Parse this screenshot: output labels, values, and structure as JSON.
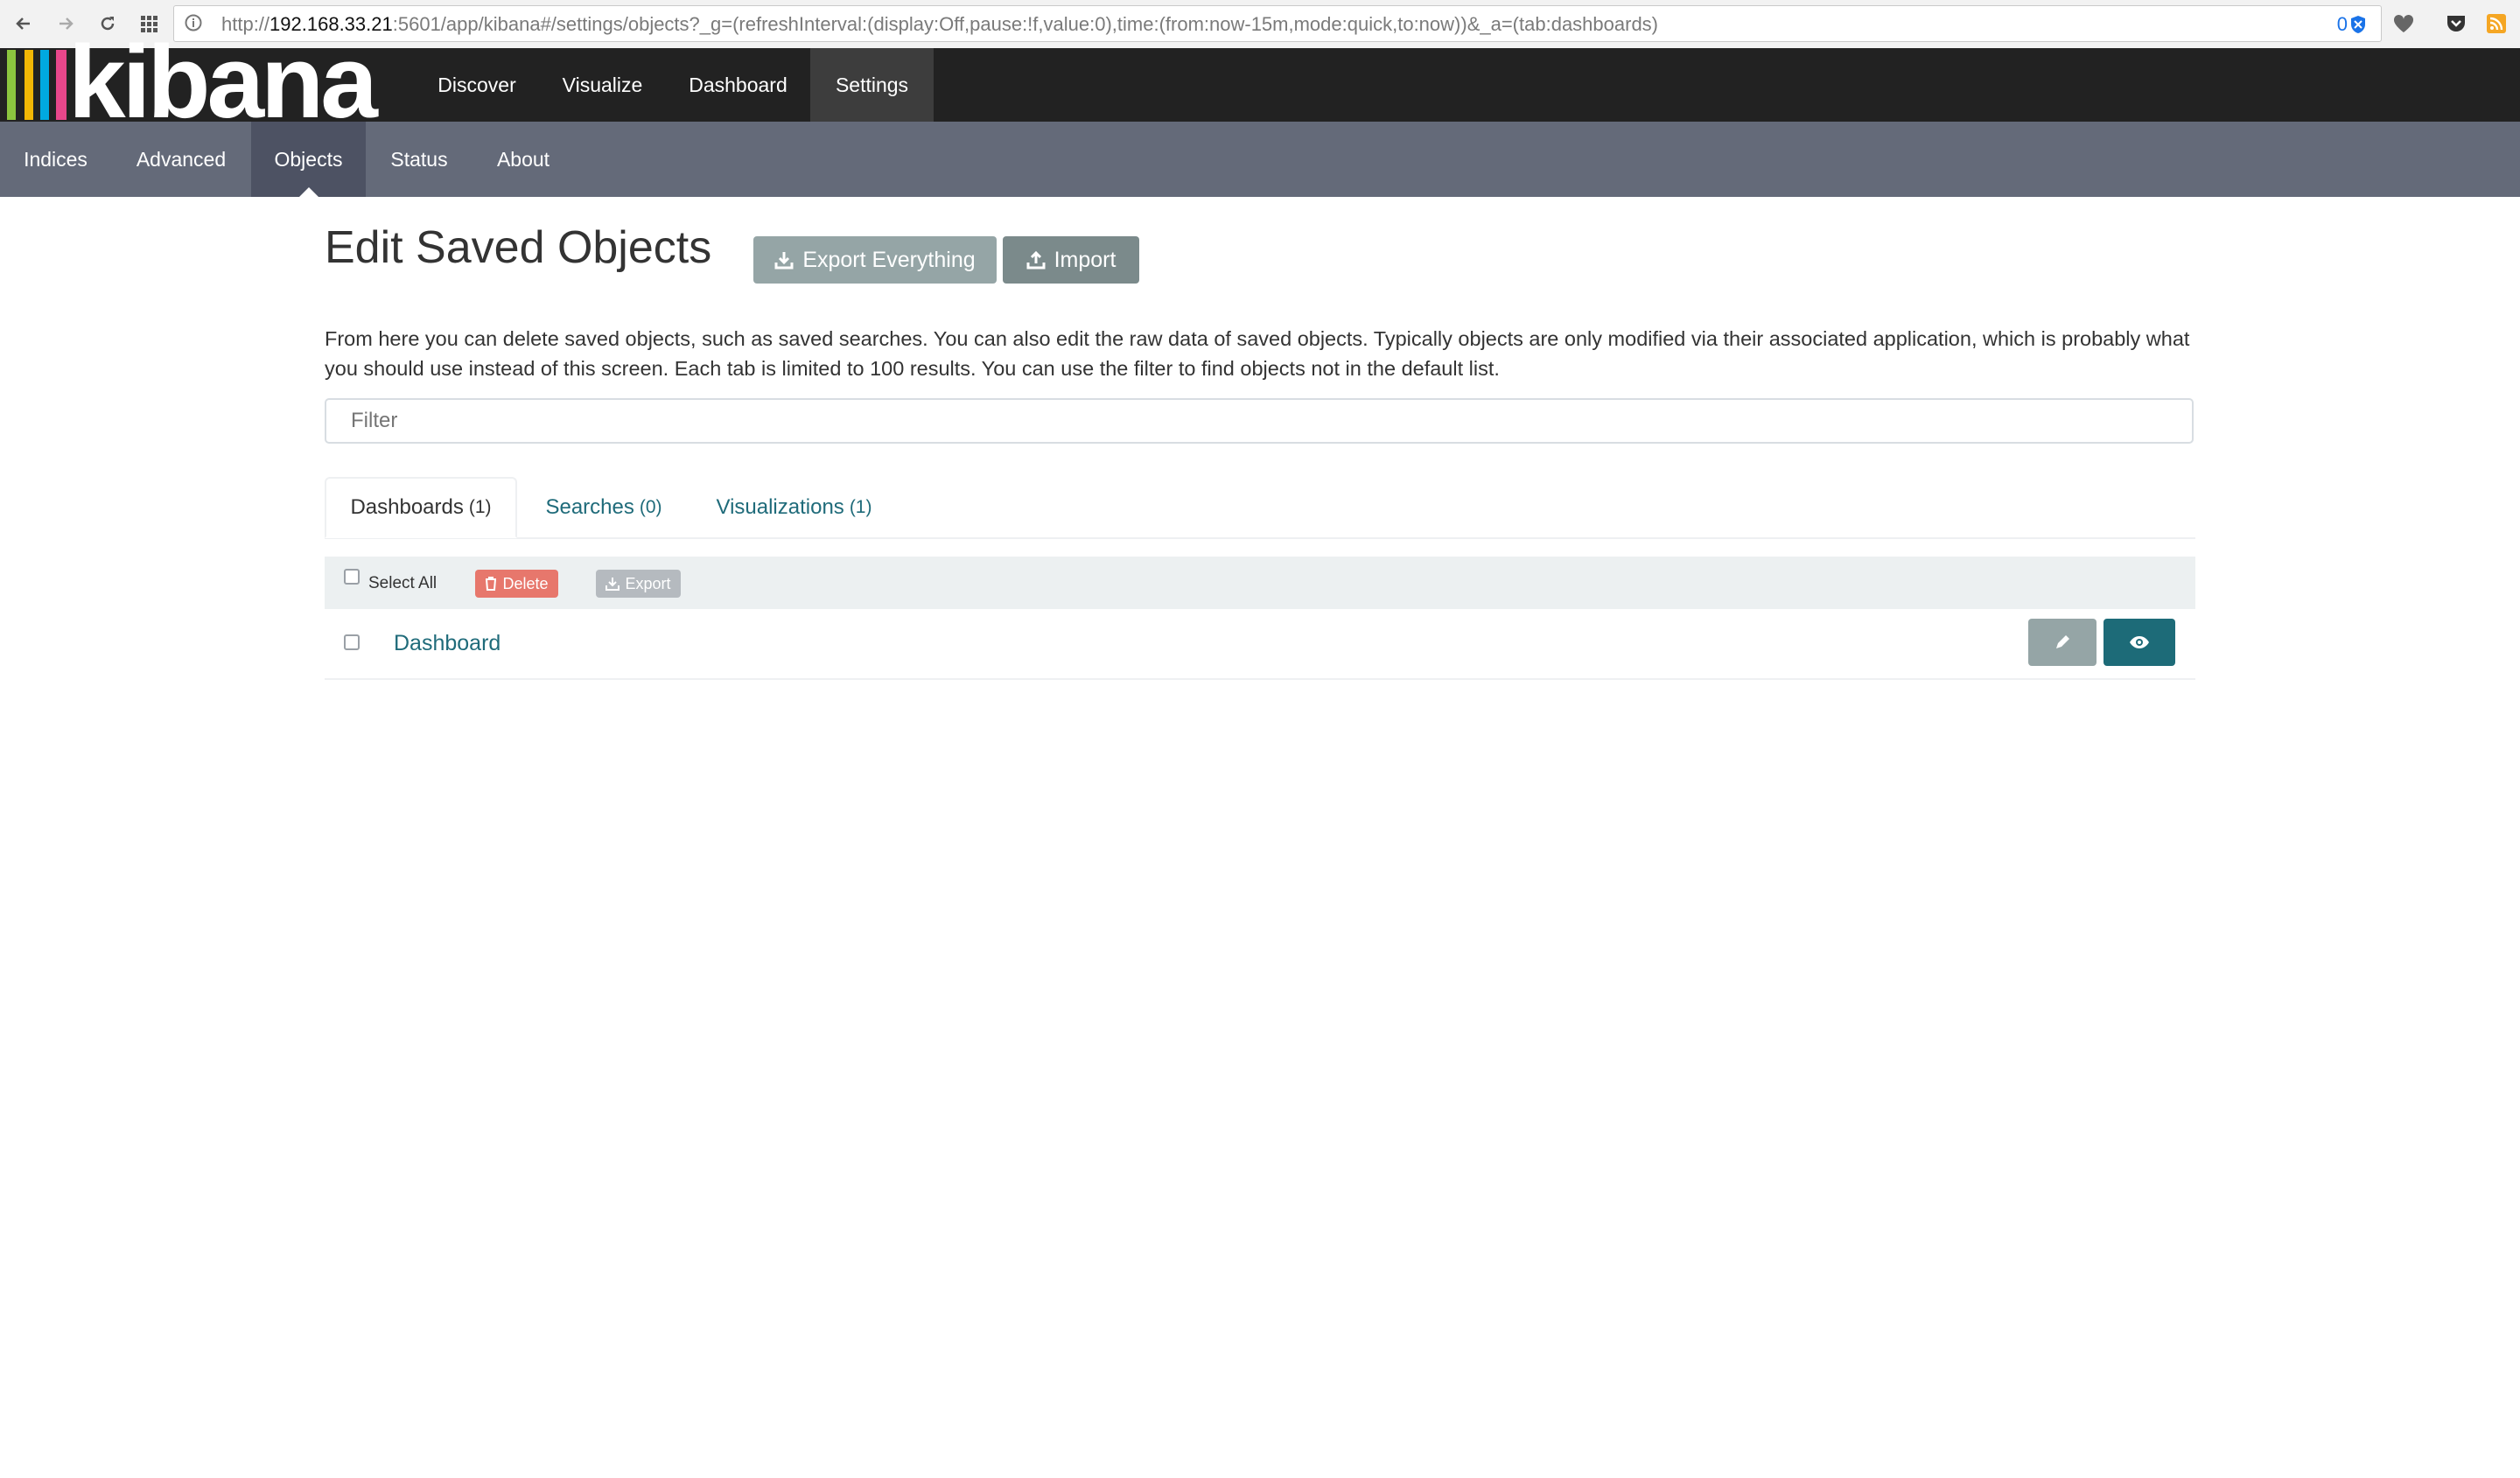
{
  "browser": {
    "url_scheme": "http://",
    "url_host": "192.168.33.21",
    "url_rest": ":5601/app/kibana#/settings/objects?_g=(refreshInterval:(display:Off,pause:!f,value:0),time:(from:now-15m,mode:quick,to:now))&_a=(tab:dashboards)",
    "badge_count": "0",
    "icons": [
      "back-icon",
      "forward-icon",
      "reload-icon",
      "apps-icon",
      "info-icon",
      "shield-icon",
      "heart-icon",
      "pocket-icon",
      "rss-icon"
    ]
  },
  "app": {
    "logo_text": "kibana",
    "logo_colors": [
      "#8cc63f",
      "#f2b705",
      "#00a9e0",
      "#e8478b"
    ],
    "top_tabs": [
      {
        "label": "Discover"
      },
      {
        "label": "Visualize"
      },
      {
        "label": "Dashboard"
      },
      {
        "label": "Settings"
      }
    ],
    "active_top_tab": "Settings",
    "sub_tabs": [
      {
        "label": "Indices"
      },
      {
        "label": "Advanced"
      },
      {
        "label": "Objects"
      },
      {
        "label": "Status"
      },
      {
        "label": "About"
      }
    ],
    "active_sub_tab": "Objects"
  },
  "page": {
    "title": "Edit Saved Objects",
    "export_everything_label": "Export Everything",
    "import_label": "Import",
    "description": "From here you can delete saved objects, such as saved searches. You can also edit the raw data of saved objects. Typically objects are only modified via their associated application, which is probably what you should use instead of this screen. Each tab is limited to 100 results. You can use the filter to find objects not in the default list.",
    "filter_placeholder": "Filter",
    "filter_value": "",
    "object_tabs": [
      {
        "label": "Dashboards",
        "count": "(1)"
      },
      {
        "label": "Searches",
        "count": "(0)"
      },
      {
        "label": "Visualizations",
        "count": "(1)"
      }
    ],
    "active_object_tab": "Dashboards",
    "bulk": {
      "select_all_label": "Select All",
      "delete_label": "Delete",
      "export_label": "Export"
    },
    "rows": [
      {
        "title": "Dashboard"
      }
    ],
    "colors": {
      "delete_bg": "#e7776c",
      "disabled_export_bg": "#b5babf",
      "edit_btn_bg": "#95a5a6",
      "view_btn_bg": "#1d6b78",
      "link": "#1f6b7a"
    }
  }
}
